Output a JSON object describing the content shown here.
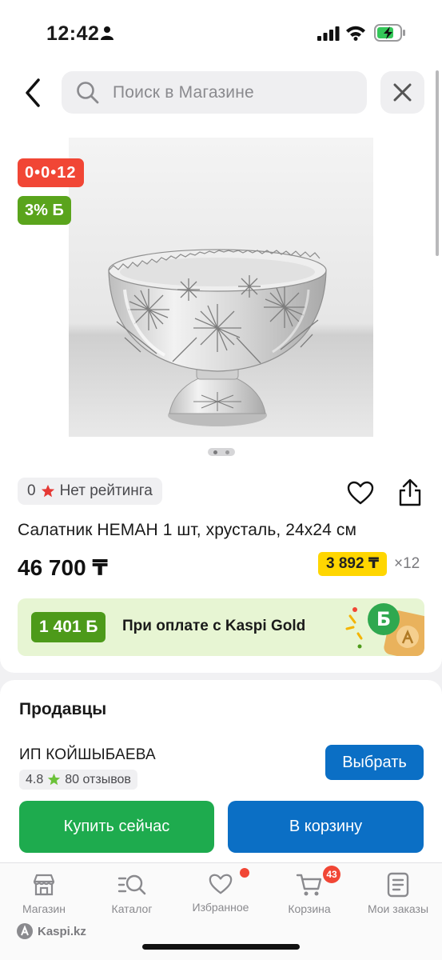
{
  "status_bar": {
    "time": "12:42"
  },
  "search": {
    "placeholder": "Поиск в Магазине"
  },
  "product": {
    "badge_installment": "0•0•12",
    "badge_bonus": "3% Б",
    "rating_value": "0",
    "rating_text": "Нет рейтинга",
    "title": "Салатник НЕМАН 1 шт, хрусталь, 24x24 см",
    "price": "46 700 ₸",
    "monthly_payment": "3 892 ₸",
    "months_multiplier": "×12",
    "image_pages_total": 2,
    "image_pages_current": 1
  },
  "kaspi_gold": {
    "bonus_amount": "1 401 Б",
    "text": "При оплате с Kaspi Gold"
  },
  "sellers": {
    "title": "Продавцы",
    "seller_name": "ИП КОЙШЫБАЕВА",
    "seller_rating": "4.8",
    "seller_reviews": "80 отзывов",
    "choose_label": "Выбрать"
  },
  "actions": {
    "buy_now": "Купить сейчас",
    "to_cart": "В корзину"
  },
  "tab_bar": {
    "items": [
      {
        "label": "Магазин",
        "icon": "store-icon"
      },
      {
        "label": "Каталог",
        "icon": "catalog-search-icon"
      },
      {
        "label": "Избранное",
        "icon": "heart-icon"
      },
      {
        "label": "Корзина",
        "icon": "cart-icon"
      },
      {
        "label": "Мои заказы",
        "icon": "orders-icon"
      }
    ],
    "cart_count": "43"
  },
  "branding": {
    "logo_text": "Kaspi.kz"
  },
  "colors": {
    "installment_red": "#f14635",
    "bonus_green": "#5aa41c",
    "kaspi_blue": "#0b6fc5",
    "buy_green": "#1eab4e",
    "monthly_yellow": "#ffd600"
  }
}
